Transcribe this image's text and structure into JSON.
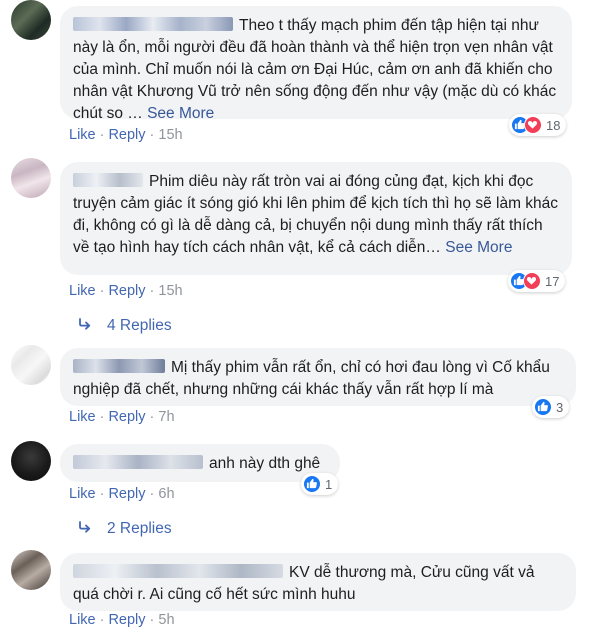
{
  "colors": {
    "link": "#4267b2",
    "bubble": "#f2f3f5",
    "like_blue": "#1877f2",
    "love_red": "#f33e58"
  },
  "actions": {
    "like": "Like",
    "reply": "Reply"
  },
  "comments": [
    {
      "text": "Theo t thấy mạch phim đến tập hiện tại như này là ổn, mỗi người đều đã hoàn thành và thể hiện trọn vẹn nhân vật của mình. Chỉ muốn nói là cảm ơn Đại Húc, cảm ơn anh đã khiến cho nhân vật Khương Vũ trở nên sống động đến như vậy (mặc dù có khác chút so …",
      "see_more": "See More",
      "time": "15h",
      "reaction_count": "18",
      "reactions": [
        "like-icon",
        "love-icon"
      ]
    },
    {
      "text": "Phim diêu này rất tròn vai ai đóng củng đạt, kịch khi đọc truyện cảm giác ít sóng gió khi lên phim để kịch tích thì họ sẽ làm khác đi, không có gì là dễ dàng cả, bị chuyển nội dung mình thấy rất thích về tạo hình hay tích cách nhân vật, kể cả cách diễn…",
      "see_more": "See More",
      "time": "15h",
      "reaction_count": "17",
      "reactions": [
        "like-icon",
        "love-icon"
      ],
      "replies": "4 Replies"
    },
    {
      "text": "Mị thấy phim vẫn rất ổn, chỉ có hơi đau lòng vì Cố khẩu nghiệp đã chết, nhưng những cái khác thấy vẫn rất hợp lí mà",
      "time": "7h",
      "reaction_count": "3",
      "reactions": [
        "like-icon"
      ]
    },
    {
      "text": "anh này dth ghê",
      "time": "6h",
      "reaction_count": "1",
      "reactions": [
        "like-icon"
      ],
      "replies": "2 Replies"
    },
    {
      "text": "KV dễ thương mà, Cửu cũng vất vả quá chời r. Ai cũng cố hết sức mình huhu",
      "time": "5h"
    }
  ]
}
